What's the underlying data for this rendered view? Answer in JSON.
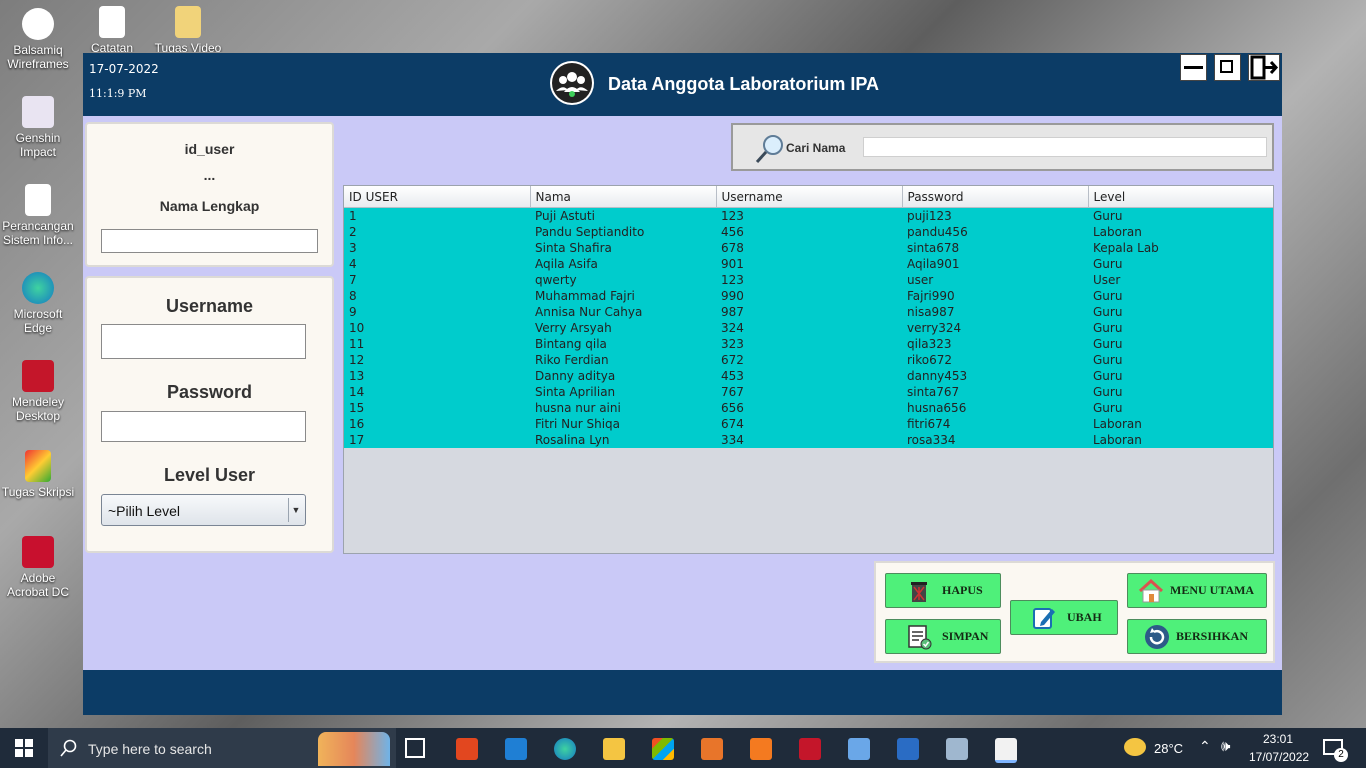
{
  "desktop": {
    "icons": [
      {
        "label": "Balsamiq Wireframes"
      },
      {
        "label": "Catatan"
      },
      {
        "label": "Tugas Video"
      },
      {
        "label": "Genshin Impact"
      },
      {
        "label": "Perancangan Sistem Info..."
      },
      {
        "label": "Microsoft Edge"
      },
      {
        "label": "Mendeley Desktop"
      },
      {
        "label": "Tugas Skripsi"
      },
      {
        "label": "Adobe Acrobat DC"
      }
    ]
  },
  "header": {
    "date": "17-07-2022",
    "time": "11:1:9 PM",
    "title": "Data Anggota Laboratorium IPA"
  },
  "left_panel": {
    "id_label": "id_user",
    "id_value": "...",
    "fullname_label": "Nama Lengkap",
    "fullname_value": "",
    "username_label": "Username",
    "username_value": "",
    "password_label": "Password",
    "password_value": "",
    "level_label": "Level User",
    "level_selected": "~Pilih Level"
  },
  "search": {
    "label": "Cari Nama",
    "value": ""
  },
  "table": {
    "columns": [
      "ID USER",
      "Nama",
      "Username",
      "Password",
      "Level"
    ],
    "rows": [
      [
        "1",
        "Puji Astuti",
        "123",
        "puji123",
        "Guru"
      ],
      [
        "2",
        "Pandu Septiandito",
        "456",
        "pandu456",
        "Laboran"
      ],
      [
        "3",
        "Sinta Shafira",
        "678",
        "sinta678",
        "Kepala Lab"
      ],
      [
        "4",
        "Aqila Asifa",
        "901",
        "Aqila901",
        "Guru"
      ],
      [
        "7",
        "qwerty",
        "123",
        "user",
        "User"
      ],
      [
        "8",
        "Muhammad Fajri",
        "990",
        "Fajri990",
        "Guru"
      ],
      [
        "9",
        "Annisa Nur Cahya",
        "987",
        "nisa987",
        "Guru"
      ],
      [
        "10",
        "Verry Arsyah",
        "324",
        "verry324",
        "Guru"
      ],
      [
        "11",
        "Bintang qila",
        "323",
        "qila323",
        "Guru"
      ],
      [
        "12",
        "Riko Ferdian",
        "672",
        "riko672",
        "Guru"
      ],
      [
        "13",
        "Danny aditya",
        "453",
        "danny453",
        "Guru"
      ],
      [
        "14",
        "Sinta Aprilian",
        "767",
        "sinta767",
        "Guru"
      ],
      [
        "15",
        "husna nur aini",
        "656",
        "husna656",
        "Guru"
      ],
      [
        "16",
        "Fitri Nur Shiqa",
        "674",
        "fitri674",
        "Laboran"
      ],
      [
        "17",
        "Rosalina Lyn",
        "334",
        "rosa334",
        "Laboran"
      ]
    ]
  },
  "buttons": {
    "hapus": "HAPUS",
    "simpan": "SIMPAN",
    "ubah": "UBAH",
    "menu_utama": "MENU UTAMA",
    "bersihkan": "BERSIHKAN"
  },
  "taskbar": {
    "search_placeholder": "Type here to search",
    "temperature": "28°C",
    "clock_time": "23:01",
    "clock_date": "17/07/2022",
    "notification_count": "2"
  },
  "colors": {
    "header_bg": "#0c3c66",
    "window_bg": "#cac9f7",
    "row_bg": "#00cccc",
    "button_bg": "#4ff07a"
  }
}
